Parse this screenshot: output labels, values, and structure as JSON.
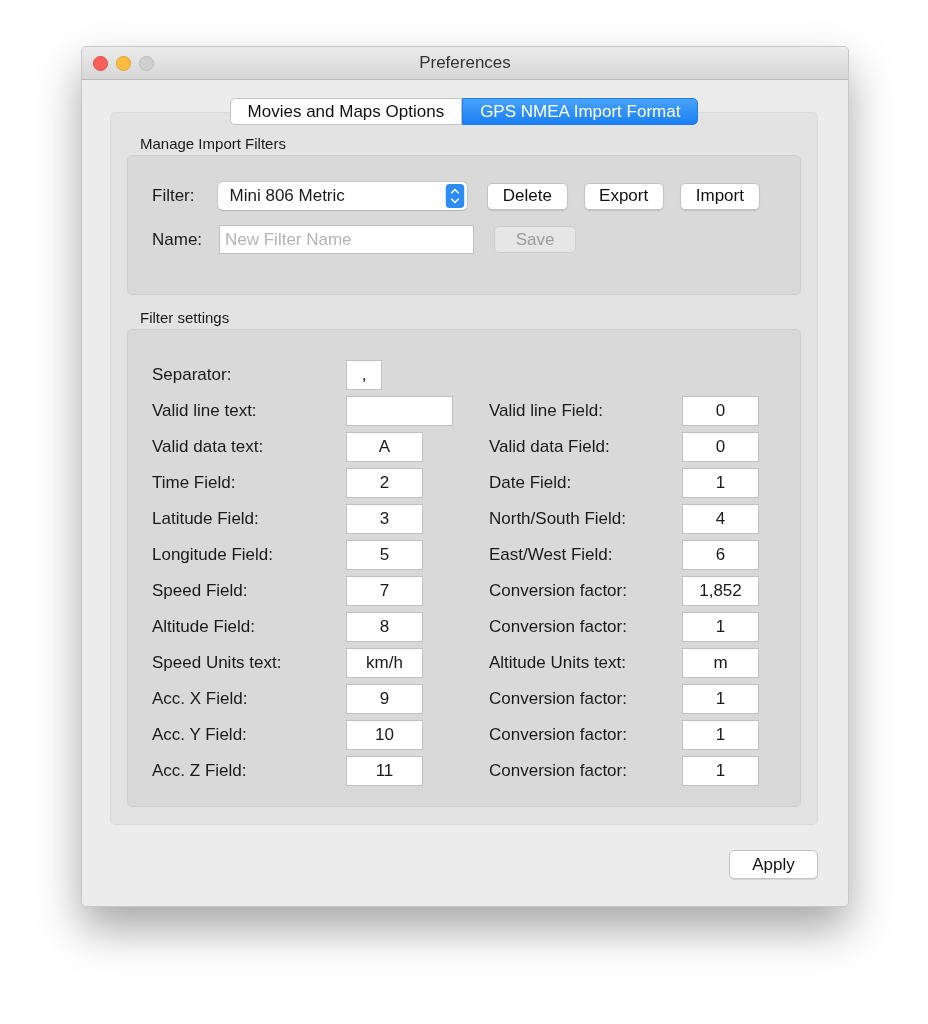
{
  "window": {
    "title": "Preferences"
  },
  "tabs": [
    {
      "label": "Movies and Maps Options",
      "selected": false
    },
    {
      "label": "GPS NMEA Import Format",
      "selected": true
    }
  ],
  "manage": {
    "title": "Manage Import Filters",
    "filter_label": "Filter:",
    "filter_value": "Mini 806 Metric",
    "buttons": [
      {
        "label": "Delete",
        "disabled": false
      },
      {
        "label": "Export",
        "disabled": false
      },
      {
        "label": "Import",
        "disabled": false
      }
    ],
    "name_label": "Name:",
    "name_placeholder": "New Filter Name",
    "save": {
      "label": "Save",
      "disabled": true
    }
  },
  "settings": {
    "title": "Filter settings",
    "rows": [
      {
        "left": {
          "label": "Separator:",
          "value": ",",
          "kind": "narrow"
        }
      },
      {
        "left": {
          "label": "Valid line text:",
          "kind": "wide"
        },
        "right": {
          "label": "Valid line Field:",
          "value": "0",
          "kind": "normal"
        }
      },
      {
        "left": {
          "label": "Valid data text:",
          "value": "A",
          "kind": "normal"
        },
        "right": {
          "label": "Valid data Field:",
          "value": "0",
          "kind": "normal"
        }
      },
      {
        "left": {
          "label": "Time Field:",
          "value": "2",
          "kind": "normal"
        },
        "right": {
          "label": "Date Field:",
          "value": "1",
          "kind": "normal"
        }
      },
      {
        "left": {
          "label": "Latitude Field:",
          "value": "3",
          "kind": "normal"
        },
        "right": {
          "label": "North/South Field:",
          "value": "4",
          "kind": "normal"
        }
      },
      {
        "left": {
          "label": "Longitude Field:",
          "value": "5",
          "kind": "normal"
        },
        "right": {
          "label": "East/West Field:",
          "value": "6",
          "kind": "normal"
        }
      },
      {
        "left": {
          "label": "Speed Field:",
          "value": "7",
          "kind": "normal"
        },
        "right": {
          "label": "Conversion factor:",
          "value": "1,852",
          "kind": "normal"
        }
      },
      {
        "left": {
          "label": "Altitude Field:",
          "value": "8",
          "kind": "normal"
        },
        "right": {
          "label": "Conversion factor:",
          "value": "1",
          "kind": "normal"
        }
      },
      {
        "left": {
          "label": "Speed Units text:",
          "value": "km/h",
          "kind": "normal"
        },
        "right": {
          "label": "Altitude Units text:",
          "value": "m",
          "kind": "normal"
        }
      },
      {
        "left": {
          "label": "Acc. X Field:",
          "value": "9",
          "kind": "normal"
        },
        "right": {
          "label": "Conversion factor:",
          "value": "1",
          "kind": "normal"
        }
      },
      {
        "left": {
          "label": "Acc. Y Field:",
          "value": "10",
          "kind": "normal"
        },
        "right": {
          "label": "Conversion factor:",
          "value": "1",
          "kind": "normal"
        }
      },
      {
        "left": {
          "label": "Acc. Z Field:",
          "value": "11",
          "kind": "normal"
        },
        "right": {
          "label": "Conversion factor:",
          "value": "1",
          "kind": "normal"
        }
      }
    ]
  },
  "apply_button": "Apply"
}
